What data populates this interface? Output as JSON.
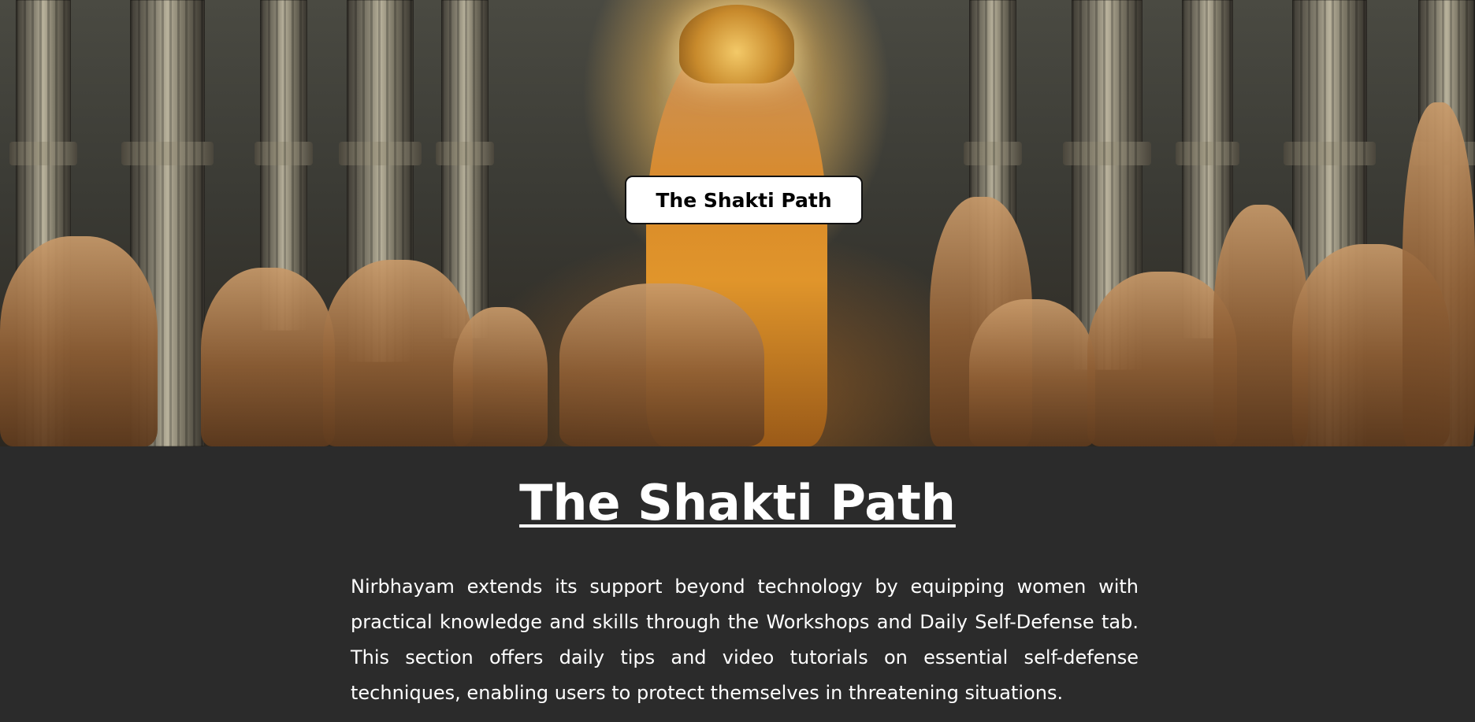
{
  "hero": {
    "badge_label": "The Shakti Path",
    "image_alt": "Goddess figure in a temple hall surrounded by kneeling men"
  },
  "section": {
    "title": "The Shakti Path",
    "description": "Nirbhayam extends its support beyond technology by equipping women with practical knowledge and skills through the Workshops and Daily Self-Defense tab. This section offers daily tips and video tutorials on essential self-defense techniques, enabling users to protect themselves in threatening situations."
  },
  "colors": {
    "page_background": "#2b2b2b",
    "text": "#ffffff",
    "badge_background": "#ffffff",
    "badge_text": "#000000"
  }
}
